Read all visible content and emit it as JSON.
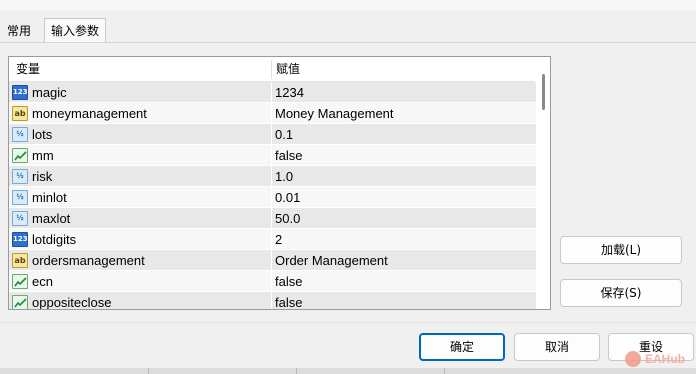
{
  "window": {
    "title_cut": ""
  },
  "tabs": [
    {
      "label": "常用",
      "active": false
    },
    {
      "label": "输入参数",
      "active": true
    }
  ],
  "table": {
    "columns": {
      "variable": "变量",
      "value": "赋值"
    },
    "rows": [
      {
        "type": "int",
        "icon": "123",
        "name": "magic",
        "value": "1234"
      },
      {
        "type": "string",
        "icon": "ab",
        "name": "moneymanagement",
        "value": "Money Management"
      },
      {
        "type": "double",
        "icon": "½",
        "name": "lots",
        "value": "0.1"
      },
      {
        "type": "bool",
        "icon": "bool-icon",
        "name": "mm",
        "value": "false"
      },
      {
        "type": "double",
        "icon": "½",
        "name": "risk",
        "value": "1.0"
      },
      {
        "type": "double",
        "icon": "½",
        "name": "minlot",
        "value": "0.01"
      },
      {
        "type": "double",
        "icon": "½",
        "name": "maxlot",
        "value": "50.0"
      },
      {
        "type": "int",
        "icon": "123",
        "name": "lotdigits",
        "value": "2"
      },
      {
        "type": "string",
        "icon": "ab",
        "name": "ordersmanagement",
        "value": "Order Management"
      },
      {
        "type": "bool",
        "icon": "bool-icon",
        "name": "ecn",
        "value": "false"
      },
      {
        "type": "bool",
        "icon": "bool-icon",
        "name": "oppositeclose",
        "value": "false"
      }
    ]
  },
  "buttons": {
    "load": "加载(L)",
    "save": "保存(S)",
    "ok": "确定",
    "cancel": "取消",
    "reset": "重设"
  },
  "watermark": {
    "text": "EAHub"
  },
  "colors": {
    "ok_border": "#0067c0",
    "row_odd": "#e8e8e8",
    "row_even": "#f7f7f7"
  }
}
